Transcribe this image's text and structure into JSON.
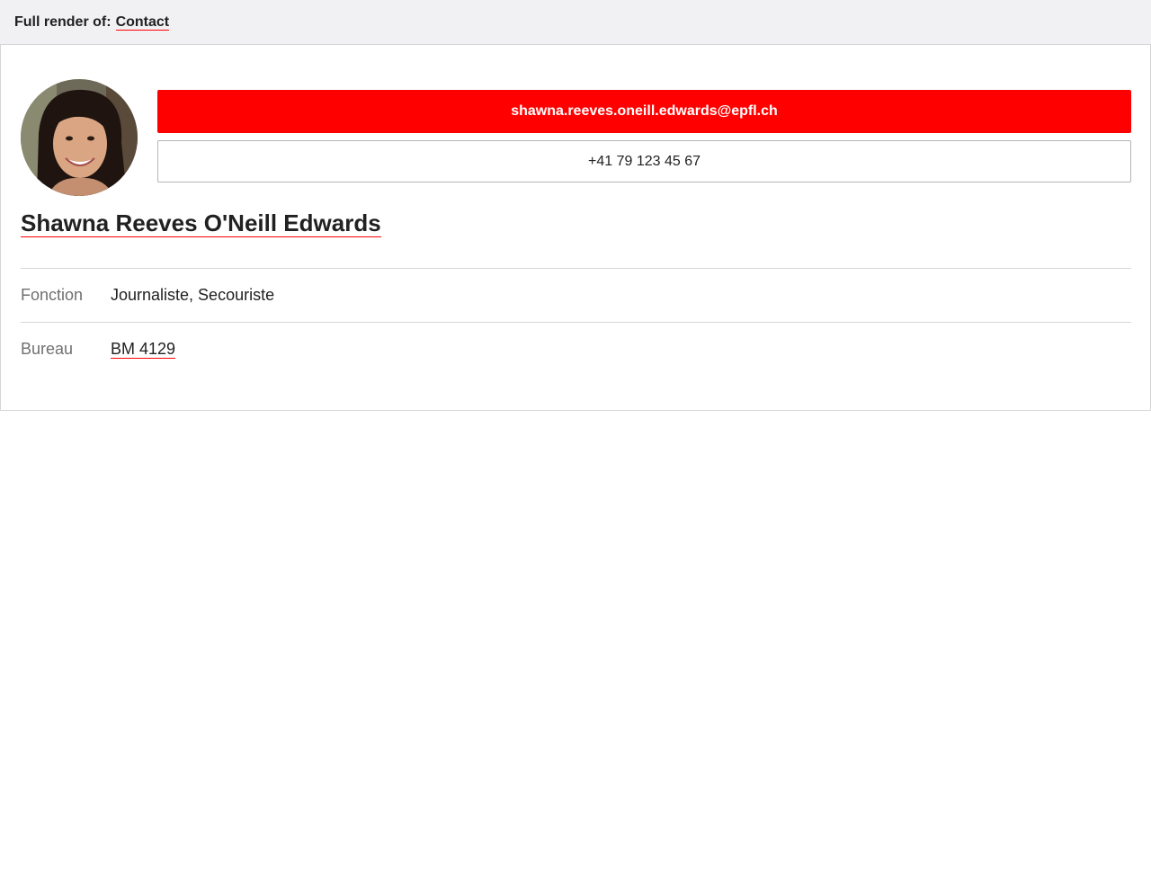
{
  "header": {
    "prefix": "Full render of:",
    "link_label": "Contact"
  },
  "contact": {
    "email": "shawna.reeves.oneill.edwards@epfl.ch",
    "phone": "+41 79 123 45 67",
    "name": "Shawna Reeves O'Neill Edwards",
    "fields": [
      {
        "label": "Fonction",
        "value": "Journaliste, Secouriste"
      },
      {
        "label": "Bureau",
        "value": "BM 4129"
      }
    ]
  },
  "colors": {
    "accent": "#ff0000",
    "header_bg": "#f1f1f3",
    "border": "#d5d5d5",
    "muted_text": "#707070"
  }
}
